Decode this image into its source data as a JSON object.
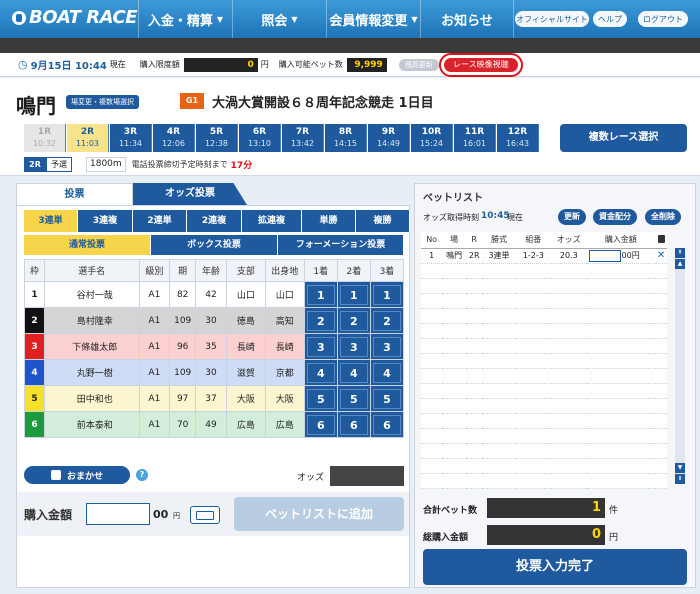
{
  "nav": {
    "logo": "BOAT RACE",
    "menus": [
      "入金・精算",
      "照会",
      "会員情報変更",
      "お知らせ"
    ],
    "official_site": "オフィシャルサイト",
    "help": "ヘルプ",
    "logout": "ログアウト"
  },
  "status": {
    "datetime": "9月15日 10:44",
    "datetime_suffix": "現在",
    "limit_label": "購入限度額",
    "limit_value": "0",
    "limit_unit": "円",
    "bets_label": "購入可能ベット数",
    "bets_value": "9,999",
    "reload_label": "残高更新",
    "video_label": "レース映像視聴"
  },
  "header": {
    "venue": "鳴門",
    "change_btn": "場変更・複数場選択",
    "grade": "G1",
    "title": "大渦大賞開設６８周年記念競走 1日目"
  },
  "races": [
    {
      "r": "1R",
      "t": "10:32",
      "state": "past"
    },
    {
      "r": "2R",
      "t": "11:03",
      "state": "sel"
    },
    {
      "r": "3R",
      "t": "11:34",
      "state": ""
    },
    {
      "r": "4R",
      "t": "12:06",
      "state": ""
    },
    {
      "r": "5R",
      "t": "12:38",
      "state": ""
    },
    {
      "r": "6R",
      "t": "13:10",
      "state": ""
    },
    {
      "r": "7R",
      "t": "13:42",
      "state": ""
    },
    {
      "r": "8R",
      "t": "14:15",
      "state": ""
    },
    {
      "r": "9R",
      "t": "14:49",
      "state": ""
    },
    {
      "r": "10R",
      "t": "15:24",
      "state": ""
    },
    {
      "r": "11R",
      "t": "16:01",
      "state": ""
    },
    {
      "r": "12R",
      "t": "16:43",
      "state": ""
    }
  ],
  "multi_race_btn": "複数レース選択",
  "race_info": {
    "race": "2R",
    "kind": "予選",
    "distance": "1800m",
    "deadline_label": "電話投票締切予定時刻まで",
    "deadline_value": "17分"
  },
  "left": {
    "tab_vote": "投票",
    "tab_odds": "オッズ投票",
    "bet_types": [
      "3連単",
      "3連複",
      "2連単",
      "2連複",
      "拡連複",
      "単勝",
      "複勝"
    ],
    "vote_modes": [
      "通常投票",
      "ボックス投票",
      "フォーメーション投票"
    ],
    "columns": [
      "枠",
      "選手名",
      "級別",
      "期",
      "年齢",
      "支部",
      "出身地",
      "1着",
      "2着",
      "3着"
    ],
    "racers": [
      {
        "waku": "1",
        "name": "谷村一哉",
        "cls": "A1",
        "ki": "82",
        "age": "42",
        "branch": "山口",
        "home": "山口",
        "bg": "#ffffff",
        "wbg": "#ffffff",
        "wfg": "#222"
      },
      {
        "waku": "2",
        "name": "島村隆幸",
        "cls": "A1",
        "ki": "109",
        "age": "30",
        "branch": "徳島",
        "home": "高知",
        "bg": "#d4d4d4",
        "wbg": "#111111",
        "wfg": "#fff"
      },
      {
        "waku": "3",
        "name": "下條雄太郎",
        "cls": "A1",
        "ki": "96",
        "age": "35",
        "branch": "長崎",
        "home": "長崎",
        "bg": "#fbd0d0",
        "wbg": "#e02020",
        "wfg": "#fff"
      },
      {
        "waku": "4",
        "name": "丸野一樹",
        "cls": "A1",
        "ki": "109",
        "age": "30",
        "branch": "滋賀",
        "home": "京都",
        "bg": "#cfdcf6",
        "wbg": "#1e55c8",
        "wfg": "#fff"
      },
      {
        "waku": "5",
        "name": "田中和也",
        "cls": "A1",
        "ki": "97",
        "age": "37",
        "branch": "大阪",
        "home": "大阪",
        "bg": "#fbf6cf",
        "wbg": "#f5e02a",
        "wfg": "#222"
      },
      {
        "waku": "6",
        "name": "前本泰和",
        "cls": "A1",
        "ki": "70",
        "age": "49",
        "branch": "広島",
        "home": "広島",
        "bg": "#d2eedb",
        "wbg": "#1e9a3e",
        "wfg": "#fff"
      }
    ],
    "omakase": "おまかせ",
    "help": "?",
    "odds_label": "オッズ",
    "buy_label": "購入金額",
    "buy_unit": "00",
    "buy_yen": "円",
    "add_btn": "ベットリストに追加"
  },
  "right": {
    "title": "ベットリスト",
    "odds_time_label": "オッズ取得時刻",
    "odds_time": "10:45",
    "odds_time_suffix": "現在",
    "btn_refresh": "更新",
    "btn_distribute": "資金配分",
    "btn_clear": "全削除",
    "columns": [
      "No",
      "場",
      "R",
      "勝式",
      "組番",
      "オッズ",
      "購入金額"
    ],
    "bet": {
      "no": "1",
      "venue": "鳴門",
      "race": "2R",
      "type": "3連単",
      "combo": "1-2-3",
      "odds": "20.3",
      "unit": "00円"
    },
    "total_bets_label": "合計ベット数",
    "total_bets": "1",
    "total_bets_unit": "件",
    "total_amt_label": "総購入金額",
    "total_amt": "0",
    "total_amt_unit": "円",
    "done_btn": "投票入力完了"
  }
}
